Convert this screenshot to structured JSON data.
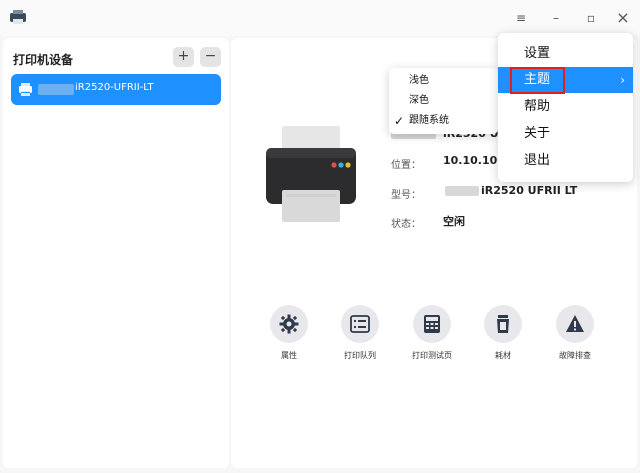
{
  "window": {
    "controls": {
      "menu_icon": "hamburger-icon",
      "minimize": "–",
      "maximize": "▫",
      "close": "×"
    }
  },
  "sidebar": {
    "title": "打印机设备",
    "add_label": "+",
    "remove_label": "−",
    "printers": [
      {
        "name": "iR2520-UFRII-LT",
        "selected": true
      }
    ]
  },
  "details": {
    "name_partial": "iR2520 U",
    "location_label": "位置：",
    "location_value": "10.10.10.",
    "model_label": "型号：",
    "model_value": "iR2520 UFRII LT",
    "status_label": "状态：",
    "status_value": "空闲"
  },
  "actions": [
    {
      "label": "属性",
      "icon": "gear-icon"
    },
    {
      "label": "打印队列",
      "icon": "queue-icon"
    },
    {
      "label": "打印测试页",
      "icon": "test-page-icon"
    },
    {
      "label": "耗材",
      "icon": "supplies-icon"
    },
    {
      "label": "故障排查",
      "icon": "warning-icon"
    }
  ],
  "main_menu": {
    "items": [
      {
        "label": "设置"
      },
      {
        "label": "主题",
        "active": true,
        "has_submenu": true
      },
      {
        "label": "帮助"
      },
      {
        "label": "关于"
      },
      {
        "label": "退出"
      }
    ]
  },
  "theme_submenu": {
    "items": [
      {
        "label": "浅色",
        "checked": false
      },
      {
        "label": "深色",
        "checked": false
      },
      {
        "label": "跟随系统",
        "checked": true
      }
    ]
  },
  "colors": {
    "accent": "#1e90ff",
    "highlight_box": "#e02020"
  }
}
